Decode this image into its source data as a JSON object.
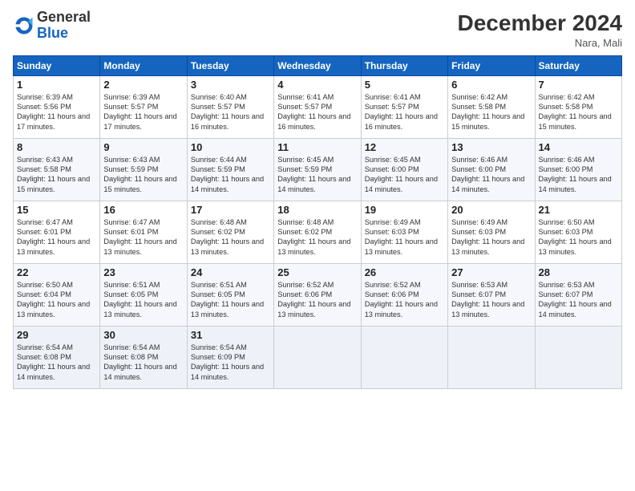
{
  "logo": {
    "general": "General",
    "blue": "Blue"
  },
  "title": "December 2024",
  "location": "Nara, Mali",
  "days": [
    "Sunday",
    "Monday",
    "Tuesday",
    "Wednesday",
    "Thursday",
    "Friday",
    "Saturday"
  ],
  "weeks": [
    [
      {
        "day": "1",
        "sunrise": "6:39 AM",
        "sunset": "5:56 PM",
        "daylight": "11 hours and 17 minutes."
      },
      {
        "day": "2",
        "sunrise": "6:39 AM",
        "sunset": "5:57 PM",
        "daylight": "11 hours and 17 minutes."
      },
      {
        "day": "3",
        "sunrise": "6:40 AM",
        "sunset": "5:57 PM",
        "daylight": "11 hours and 16 minutes."
      },
      {
        "day": "4",
        "sunrise": "6:41 AM",
        "sunset": "5:57 PM",
        "daylight": "11 hours and 16 minutes."
      },
      {
        "day": "5",
        "sunrise": "6:41 AM",
        "sunset": "5:57 PM",
        "daylight": "11 hours and 16 minutes."
      },
      {
        "day": "6",
        "sunrise": "6:42 AM",
        "sunset": "5:58 PM",
        "daylight": "11 hours and 15 minutes."
      },
      {
        "day": "7",
        "sunrise": "6:42 AM",
        "sunset": "5:58 PM",
        "daylight": "11 hours and 15 minutes."
      }
    ],
    [
      {
        "day": "8",
        "sunrise": "6:43 AM",
        "sunset": "5:58 PM",
        "daylight": "11 hours and 15 minutes."
      },
      {
        "day": "9",
        "sunrise": "6:43 AM",
        "sunset": "5:59 PM",
        "daylight": "11 hours and 15 minutes."
      },
      {
        "day": "10",
        "sunrise": "6:44 AM",
        "sunset": "5:59 PM",
        "daylight": "11 hours and 14 minutes."
      },
      {
        "day": "11",
        "sunrise": "6:45 AM",
        "sunset": "5:59 PM",
        "daylight": "11 hours and 14 minutes."
      },
      {
        "day": "12",
        "sunrise": "6:45 AM",
        "sunset": "6:00 PM",
        "daylight": "11 hours and 14 minutes."
      },
      {
        "day": "13",
        "sunrise": "6:46 AM",
        "sunset": "6:00 PM",
        "daylight": "11 hours and 14 minutes."
      },
      {
        "day": "14",
        "sunrise": "6:46 AM",
        "sunset": "6:00 PM",
        "daylight": "11 hours and 14 minutes."
      }
    ],
    [
      {
        "day": "15",
        "sunrise": "6:47 AM",
        "sunset": "6:01 PM",
        "daylight": "11 hours and 13 minutes."
      },
      {
        "day": "16",
        "sunrise": "6:47 AM",
        "sunset": "6:01 PM",
        "daylight": "11 hours and 13 minutes."
      },
      {
        "day": "17",
        "sunrise": "6:48 AM",
        "sunset": "6:02 PM",
        "daylight": "11 hours and 13 minutes."
      },
      {
        "day": "18",
        "sunrise": "6:48 AM",
        "sunset": "6:02 PM",
        "daylight": "11 hours and 13 minutes."
      },
      {
        "day": "19",
        "sunrise": "6:49 AM",
        "sunset": "6:03 PM",
        "daylight": "11 hours and 13 minutes."
      },
      {
        "day": "20",
        "sunrise": "6:49 AM",
        "sunset": "6:03 PM",
        "daylight": "11 hours and 13 minutes."
      },
      {
        "day": "21",
        "sunrise": "6:50 AM",
        "sunset": "6:03 PM",
        "daylight": "11 hours and 13 minutes."
      }
    ],
    [
      {
        "day": "22",
        "sunrise": "6:50 AM",
        "sunset": "6:04 PM",
        "daylight": "11 hours and 13 minutes."
      },
      {
        "day": "23",
        "sunrise": "6:51 AM",
        "sunset": "6:05 PM",
        "daylight": "11 hours and 13 minutes."
      },
      {
        "day": "24",
        "sunrise": "6:51 AM",
        "sunset": "6:05 PM",
        "daylight": "11 hours and 13 minutes."
      },
      {
        "day": "25",
        "sunrise": "6:52 AM",
        "sunset": "6:06 PM",
        "daylight": "11 hours and 13 minutes."
      },
      {
        "day": "26",
        "sunrise": "6:52 AM",
        "sunset": "6:06 PM",
        "daylight": "11 hours and 13 minutes."
      },
      {
        "day": "27",
        "sunrise": "6:53 AM",
        "sunset": "6:07 PM",
        "daylight": "11 hours and 13 minutes."
      },
      {
        "day": "28",
        "sunrise": "6:53 AM",
        "sunset": "6:07 PM",
        "daylight": "11 hours and 14 minutes."
      }
    ],
    [
      {
        "day": "29",
        "sunrise": "6:54 AM",
        "sunset": "6:08 PM",
        "daylight": "11 hours and 14 minutes."
      },
      {
        "day": "30",
        "sunrise": "6:54 AM",
        "sunset": "6:08 PM",
        "daylight": "11 hours and 14 minutes."
      },
      {
        "day": "31",
        "sunrise": "6:54 AM",
        "sunset": "6:09 PM",
        "daylight": "11 hours and 14 minutes."
      },
      null,
      null,
      null,
      null
    ]
  ]
}
